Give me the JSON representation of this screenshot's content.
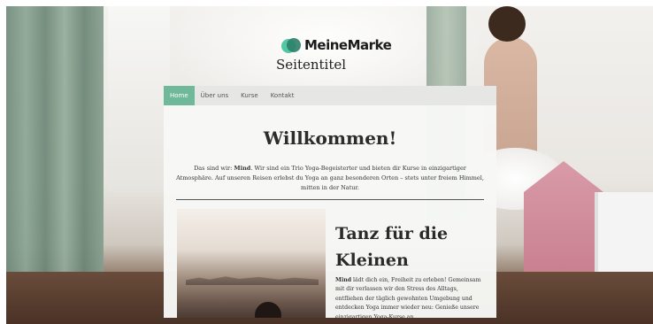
{
  "brand": {
    "name": "MeineMarke",
    "site_title": "Seitentitel",
    "logo_colors": [
      "#53c6a6",
      "#2b7f6a"
    ]
  },
  "nav": {
    "items": [
      {
        "label": "Home",
        "active": true
      },
      {
        "label": "Über uns",
        "active": false
      },
      {
        "label": "Kurse",
        "active": false
      },
      {
        "label": "Kontakt",
        "active": false
      }
    ],
    "active_color": "#6fb89a"
  },
  "main": {
    "heading": "Willkommen!",
    "intro_prefix": "Das sind wir: ",
    "intro_bold": "Mind",
    "intro_rest": ". Wir sind ein Trio Yoga-Begeisterter und bieten dir Kurse in einzigartiger Atmosphäre. Auf unseren Reisen erlebst du Yoga an ganz besonderen Orten – stets unter freiem Himmel, mitten in der Natur."
  },
  "article": {
    "title": "Tanz für die Kleinen",
    "text_bold": "Mind",
    "text_rest": " lädt dich ein, Freiheit zu erleben! Gemeinsam mit dir verlassen wir den Stress des Alltags, entfliehen der täglich gewohnten Umgebung und entdecken Yoga immer wieder neu: Genieße unsere einzigartigen Yoga-Kurse an"
  }
}
